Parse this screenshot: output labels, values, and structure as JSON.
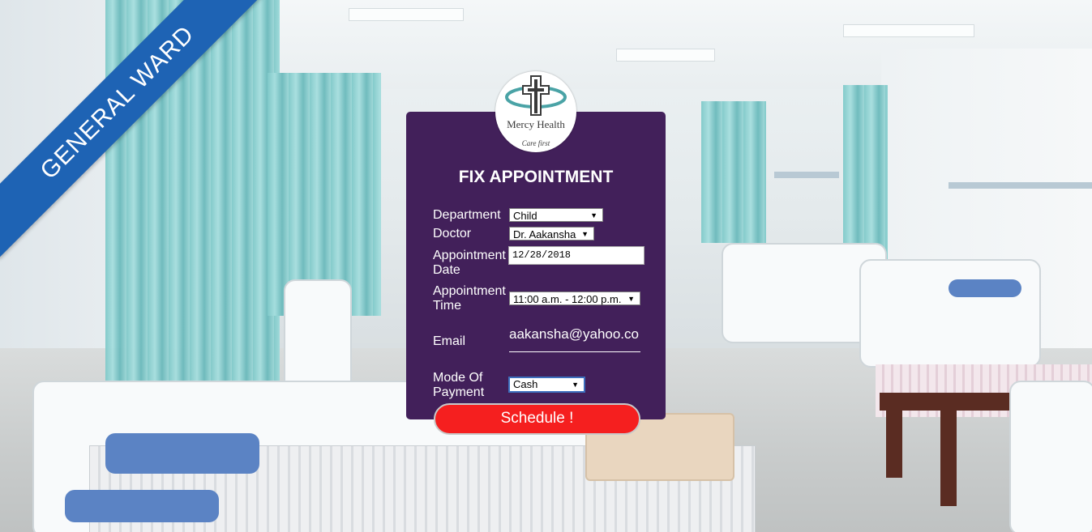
{
  "banner": {
    "text": "GENERAL WARD"
  },
  "logo": {
    "name": "Mercy Health",
    "tagline": "Care first"
  },
  "form": {
    "title": "FIX APPOINTMENT",
    "department": {
      "label": "Department",
      "value": "Child"
    },
    "doctor": {
      "label": "Doctor",
      "value": "Dr. Aakansha"
    },
    "date": {
      "label_line1": "Appointment",
      "label_line2": "Date",
      "value": "12/28/2018"
    },
    "time": {
      "label_line1": "Appointment",
      "label_line2": "Time",
      "value": "11:00 a.m. - 12:00 p.m."
    },
    "email": {
      "label": "Email",
      "value": "aakansha@yahoo.co"
    },
    "payment": {
      "label_line1": "Mode Of",
      "label_line2": "Payment",
      "value": "Cash"
    },
    "submit_label": "Schedule !"
  },
  "colors": {
    "panel": "#42205a",
    "button": "#f51f1f",
    "ribbon": "#1e63b4"
  }
}
